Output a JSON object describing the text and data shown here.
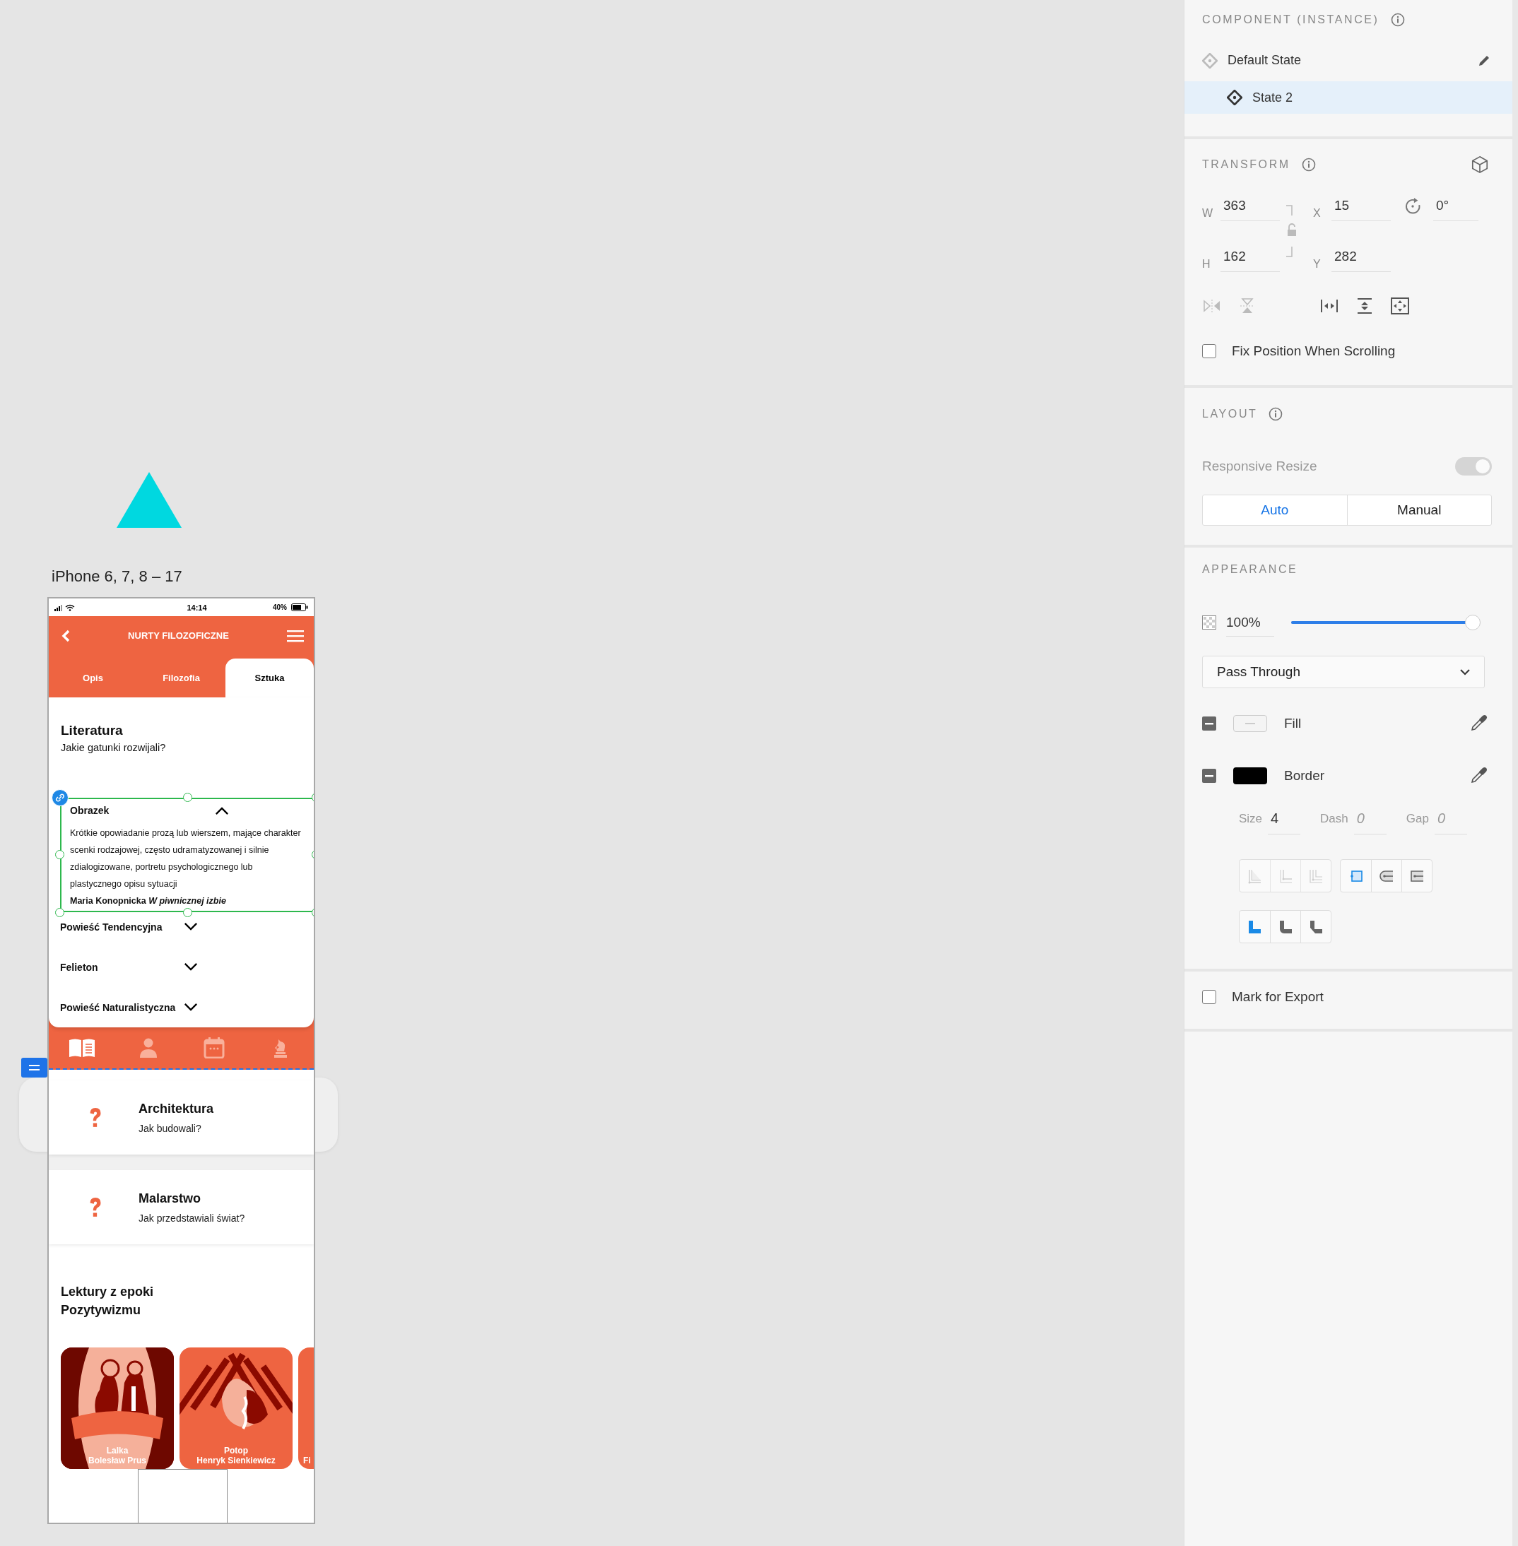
{
  "canvas": {
    "artboard_label": "iPhone 6, 7, 8 – 17"
  },
  "phone": {
    "status_bar": {
      "time": "14:14",
      "battery": "40%"
    },
    "header": {
      "title": "NURTY FILOZOFICZNE"
    },
    "tabs": [
      {
        "label": "Opis",
        "selected": false
      },
      {
        "label": "Filozofia",
        "selected": false
      },
      {
        "label": "Sztuka",
        "selected": true
      }
    ],
    "section": {
      "title": "Literatura",
      "subtitle": "Jakie gatunki rozwijali?"
    },
    "accordion": [
      {
        "title": "Obrazek",
        "expanded": true,
        "selected": true,
        "description": "Krótkie opowiadanie prozą lub wierszem, mające charakter scenki rodzajowej, często udramatyzowanej i silnie zdialogizowane, portretu psychologicznego lub plastycznego opisu sytuacji",
        "source": "Maria Konopnicka *W piwnicznej izbie*"
      },
      {
        "title": "Powieść Tendencyjna",
        "expanded": false,
        "selected": false
      },
      {
        "title": "Felieton",
        "expanded": false,
        "selected": false
      },
      {
        "title": "Powieść Naturalistyczna",
        "expanded": false,
        "selected": false
      }
    ],
    "bottom_nav": [
      {
        "kind": "book",
        "selected": true
      },
      {
        "kind": "person",
        "selected": false
      },
      {
        "kind": "calendar",
        "selected": false
      },
      {
        "kind": "knight",
        "selected": false
      }
    ],
    "topic_cards": [
      {
        "title": "Architektura",
        "subtitle": "Jak budowali?",
        "hovered": true
      },
      {
        "title": "Malarstwo",
        "subtitle": "Jak przedstawiali świat?",
        "hovered": false
      }
    ],
    "readings": {
      "title": "Lektury z epoki Pozytywizmu",
      "books": [
        {
          "kind": "picture",
          "title": "Lalka",
          "author": "Bolesław Prus",
          "color": "#8b0a00"
        },
        {
          "kind": "picture",
          "title": "Potop",
          "author": "Henryk Sienkiewicz",
          "color": "#ee6441"
        },
        {
          "kind": "plain",
          "author": "Fi",
          "color": "#ee6441"
        }
      ]
    }
  },
  "inspector": {
    "component": {
      "heading": "COMPONENT (INSTANCE)",
      "states": [
        {
          "name": "Default State",
          "selected": false
        },
        {
          "name": "State 2",
          "selected": true
        }
      ]
    },
    "transform": {
      "heading": "TRANSFORM",
      "fields": [
        {
          "label": "W",
          "value": "363"
        },
        {
          "label": "X",
          "value": "15"
        },
        {
          "label": "H",
          "value": "162"
        },
        {
          "label": "Y",
          "value": "282"
        }
      ],
      "rotation": "0°",
      "fix_position": {
        "label": "Fix Position When Scrolling",
        "checked": false
      }
    },
    "layout": {
      "heading": "LAYOUT",
      "responsive_resize": {
        "label": "Responsive Resize",
        "on": true,
        "disabled": true
      },
      "modes": [
        {
          "label": "Auto",
          "selected": true
        },
        {
          "label": "Manual",
          "selected": false
        }
      ]
    },
    "appearance": {
      "heading": "APPEARANCE",
      "opacity": {
        "value": "100%",
        "level": 1
      },
      "blend_mode": "Pass Through",
      "paints": [
        {
          "kind": "fill",
          "label": "Fill"
        },
        {
          "kind": "border",
          "label": "Border",
          "color": "#000000"
        }
      ],
      "stroke": [
        {
          "label": "Size",
          "value": "4"
        },
        {
          "label": "Dash",
          "placeholder": "0"
        },
        {
          "label": "Gap",
          "placeholder": "0"
        }
      ],
      "button_groups": [
        {
          "buttons": [
            {
              "kind": "inner",
              "selected": false,
              "disabled": true
            },
            {
              "kind": "outer",
              "selected": false,
              "disabled": true
            },
            {
              "kind": "center",
              "selected": false,
              "disabled": true
            }
          ]
        },
        {
          "buttons": [
            {
              "kind": "butt",
              "selected": true,
              "disabled": false
            },
            {
              "kind": "round",
              "selected": false,
              "disabled": false
            },
            {
              "kind": "square",
              "selected": false,
              "disabled": false
            }
          ]
        },
        {
          "buttons": [
            {
              "kind": "miter",
              "selected": true,
              "disabled": false
            },
            {
              "kind": "roundjoin",
              "selected": false,
              "disabled": false
            },
            {
              "kind": "bevel",
              "selected": false,
              "disabled": false
            }
          ]
        }
      ]
    },
    "export": {
      "label": "Mark for Export",
      "checked": false
    }
  }
}
